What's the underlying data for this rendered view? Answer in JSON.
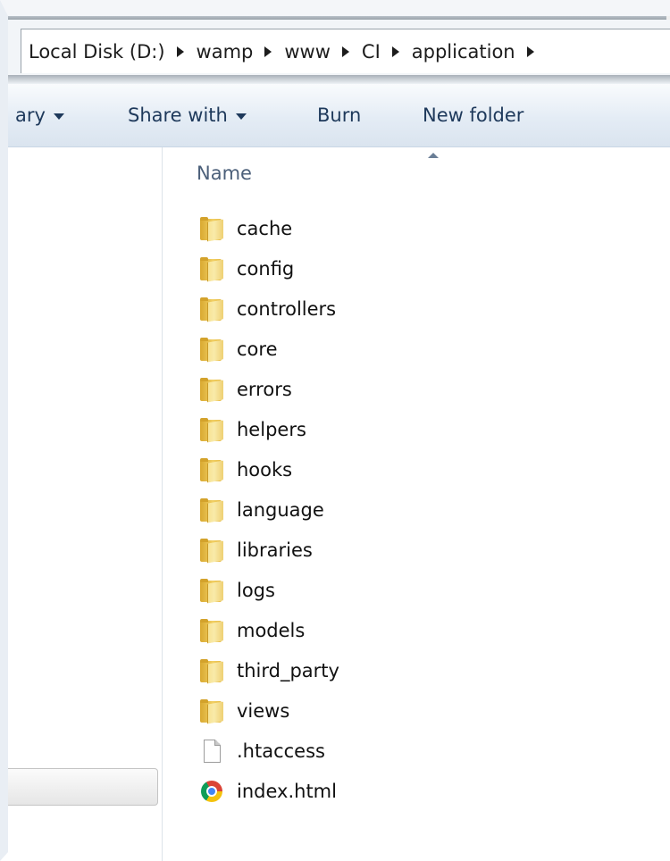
{
  "breadcrumb": {
    "items": [
      "Local Disk (D:)",
      "wamp",
      "www",
      "CI",
      "application"
    ]
  },
  "toolbar": {
    "library_label": "ary",
    "share_label": "Share with",
    "burn_label": "Burn",
    "new_folder_label": "New folder"
  },
  "filelist": {
    "header_name": "Name",
    "items": [
      {
        "name": "cache",
        "icon": "folder-icon"
      },
      {
        "name": "config",
        "icon": "folder-icon"
      },
      {
        "name": "controllers",
        "icon": "folder-icon"
      },
      {
        "name": "core",
        "icon": "folder-icon"
      },
      {
        "name": "errors",
        "icon": "folder-icon"
      },
      {
        "name": "helpers",
        "icon": "folder-icon"
      },
      {
        "name": "hooks",
        "icon": "folder-icon"
      },
      {
        "name": "language",
        "icon": "folder-icon"
      },
      {
        "name": "libraries",
        "icon": "folder-icon"
      },
      {
        "name": "logs",
        "icon": "folder-icon"
      },
      {
        "name": "models",
        "icon": "folder-icon"
      },
      {
        "name": "third_party",
        "icon": "folder-icon"
      },
      {
        "name": "views",
        "icon": "folder-icon"
      },
      {
        "name": ".htaccess",
        "icon": "file-icon"
      },
      {
        "name": "index.html",
        "icon": "chrome-icon"
      }
    ]
  }
}
